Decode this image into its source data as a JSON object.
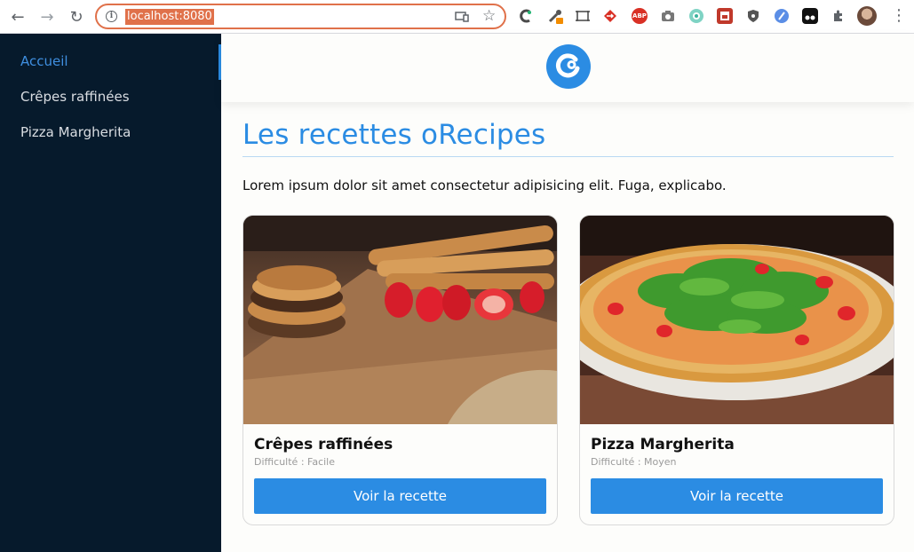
{
  "browser": {
    "url": "localhost:8080",
    "extensions": [
      "colorzilla-icon",
      "eyedropper-icon",
      "screen-capture-icon",
      "redirect-icon",
      "adblock-plus-icon",
      "camera-icon",
      "vpn-icon",
      "pdf-icon",
      "privacy-badger-icon",
      "dev-tools-icon",
      "tampermonkey-icon",
      "extensions-puzzle-icon"
    ],
    "adblock_label": "ABP",
    "accent_color": "#e0714a"
  },
  "sidebar": {
    "items": [
      {
        "label": "Accueil",
        "active": true
      },
      {
        "label": "Crêpes raffinées",
        "active": false
      },
      {
        "label": "Pizza Margherita",
        "active": false
      }
    ],
    "background": "#061a2c",
    "active_color": "#3f8fe0"
  },
  "main": {
    "title": "Les recettes oRecipes",
    "intro": "Lorem ipsum dolor sit amet consectetur adipisicing elit. Fuga, explicabo.",
    "accent_color": "#2b8ce3",
    "cards": [
      {
        "title": "Crêpes raffinées",
        "difficulty": "Difficulté : Facile",
        "button": "Voir la recette",
        "image": "crepes-photo"
      },
      {
        "title": "Pizza Margherita",
        "difficulty": "Difficulté : Moyen",
        "button": "Voir la recette",
        "image": "pizza-photo"
      }
    ]
  }
}
